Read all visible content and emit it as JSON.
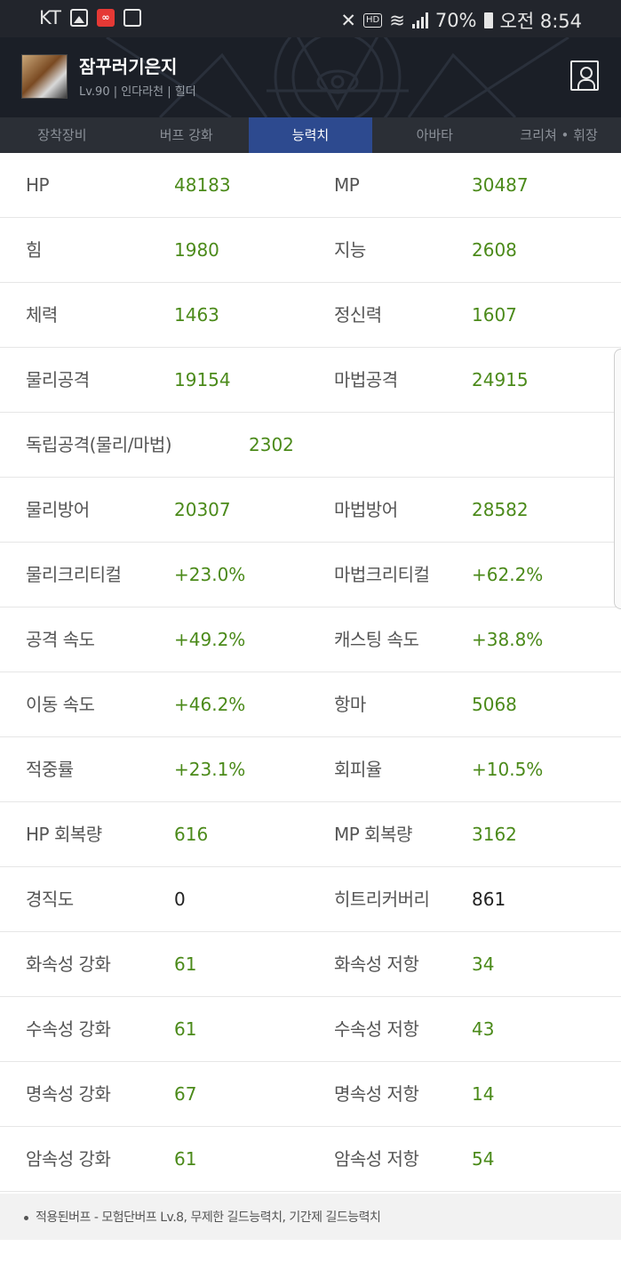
{
  "status_bar": {
    "carrier": "KT",
    "battery": "70%",
    "time": "오전 8:54"
  },
  "header": {
    "character_name": "잠꾸러기은지",
    "character_info": "Lv.90 | 인다라천 | 힐더"
  },
  "tabs": [
    {
      "label": "장착장비",
      "active": false
    },
    {
      "label": "버프 강화",
      "active": false
    },
    {
      "label": "능력치",
      "active": true
    },
    {
      "label": "아바타",
      "active": false
    },
    {
      "label": "크리쳐 • 휘장",
      "active": false
    }
  ],
  "stats": [
    {
      "l1": "HP",
      "v1": "48183",
      "l2": "MP",
      "v2": "30487"
    },
    {
      "l1": "힘",
      "v1": "1980",
      "l2": "지능",
      "v2": "2608"
    },
    {
      "l1": "체력",
      "v1": "1463",
      "l2": "정신력",
      "v2": "1607"
    },
    {
      "l1": "물리공격",
      "v1": "19154",
      "l2": "마법공격",
      "v2": "24915"
    },
    {
      "l1": "독립공격(물리/마법)",
      "v1": "2302"
    },
    {
      "l1": "물리방어",
      "v1": "20307",
      "l2": "마법방어",
      "v2": "28582"
    },
    {
      "l1": "물리크리티컬",
      "v1": "+23.0%",
      "l2": "마법크리티컬",
      "v2": "+62.2%"
    },
    {
      "l1": "공격 속도",
      "v1": "+49.2%",
      "l2": "캐스팅 속도",
      "v2": "+38.8%"
    },
    {
      "l1": "이동 속도",
      "v1": "+46.2%",
      "l2": "항마",
      "v2": "5068"
    },
    {
      "l1": "적중률",
      "v1": "+23.1%",
      "l2": "회피율",
      "v2": "+10.5%"
    },
    {
      "l1": "HP 회복량",
      "v1": "616",
      "l2": "MP 회복량",
      "v2": "3162"
    },
    {
      "l1": "경직도",
      "v1": "0",
      "l2": "히트리커버리",
      "v2": "861"
    },
    {
      "l1": "화속성 강화",
      "v1": "61",
      "l2": "화속성 저항",
      "v2": "34"
    },
    {
      "l1": "수속성 강화",
      "v1": "61",
      "l2": "수속성 저항",
      "v2": "43"
    },
    {
      "l1": "명속성 강화",
      "v1": "67",
      "l2": "명속성 저항",
      "v2": "14"
    },
    {
      "l1": "암속성 강화",
      "v1": "61",
      "l2": "암속성 저항",
      "v2": "54"
    }
  ],
  "footer": {
    "buff_note": "적용된버프 - 모험단버프 Lv.8, 무제한 길드능력치, 기간제 길드능력치"
  },
  "colors": {
    "value_green": "#4b8a1a",
    "tab_active": "#2d4a8f",
    "header_bg": "#1b1f27"
  }
}
